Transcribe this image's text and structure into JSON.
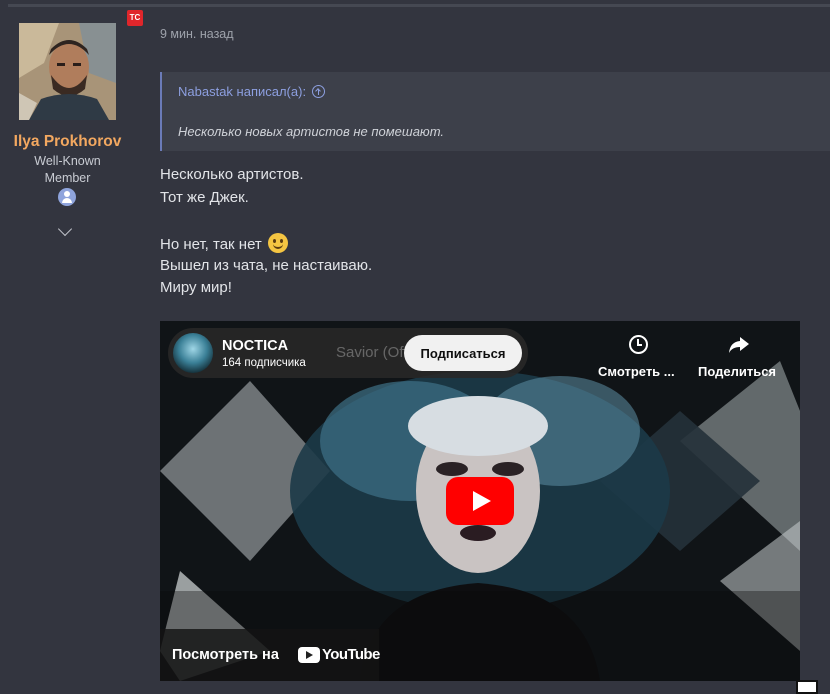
{
  "author": {
    "name": "Ilya Prokhorov",
    "title_line1": "Well-Known",
    "title_line2": "Member",
    "badge": "TC",
    "avatar_icon": "user-avatar",
    "role_icon": "user-icon",
    "expand_icon": "chevron-down-icon"
  },
  "post": {
    "time": "9 мин. назад",
    "quote": {
      "author_line": "Nabastak написал(а):",
      "text": "Несколько новых артистов не помешают."
    },
    "lines": [
      "Несколько артистов.",
      "Тот же Джек.",
      "Но нет, так нет",
      "Вышел из чата, не настаиваю.",
      "Миру мир!"
    ],
    "emoji": "smile-icon"
  },
  "video": {
    "channel_name": "NOCTICA",
    "subscribers": "164 подписчика",
    "title_fragment": "Savior (Offici",
    "subscribe_label": "Подписаться",
    "watch_later_label": "Смотреть ...",
    "share_label": "Поделиться",
    "watch_on_label": "Посмотреть на",
    "youtube_label": "YouTube"
  },
  "colors": {
    "background": "#33353f",
    "author_name": "#f3a860",
    "quote_link": "#8d9fe0",
    "play": "#ff0000"
  }
}
